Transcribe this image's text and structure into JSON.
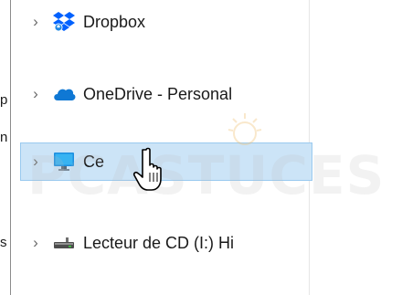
{
  "nav": {
    "items": [
      {
        "label": "Dropbox",
        "icon": "dropbox-icon",
        "selected": false
      },
      {
        "label": "OneDrive - Personal",
        "icon": "onedrive-cloud-icon",
        "selected": false
      },
      {
        "label": "Ce",
        "icon": "this-pc-monitor-icon",
        "selected": true
      },
      {
        "label": "Lecteur de CD (I:) Hi",
        "icon": "cd-drive-icon",
        "selected": false
      }
    ],
    "chevron": "›"
  },
  "left_fragments": [
    "p",
    "n",
    "s"
  ],
  "watermark": "PCASTUCES",
  "colors": {
    "selection_bg": "#cce4f7",
    "selection_border": "#99c9ef",
    "dropbox_blue": "#0061fe",
    "onedrive_blue": "#0f78d4",
    "monitor_blue": "#1c8fe0"
  }
}
